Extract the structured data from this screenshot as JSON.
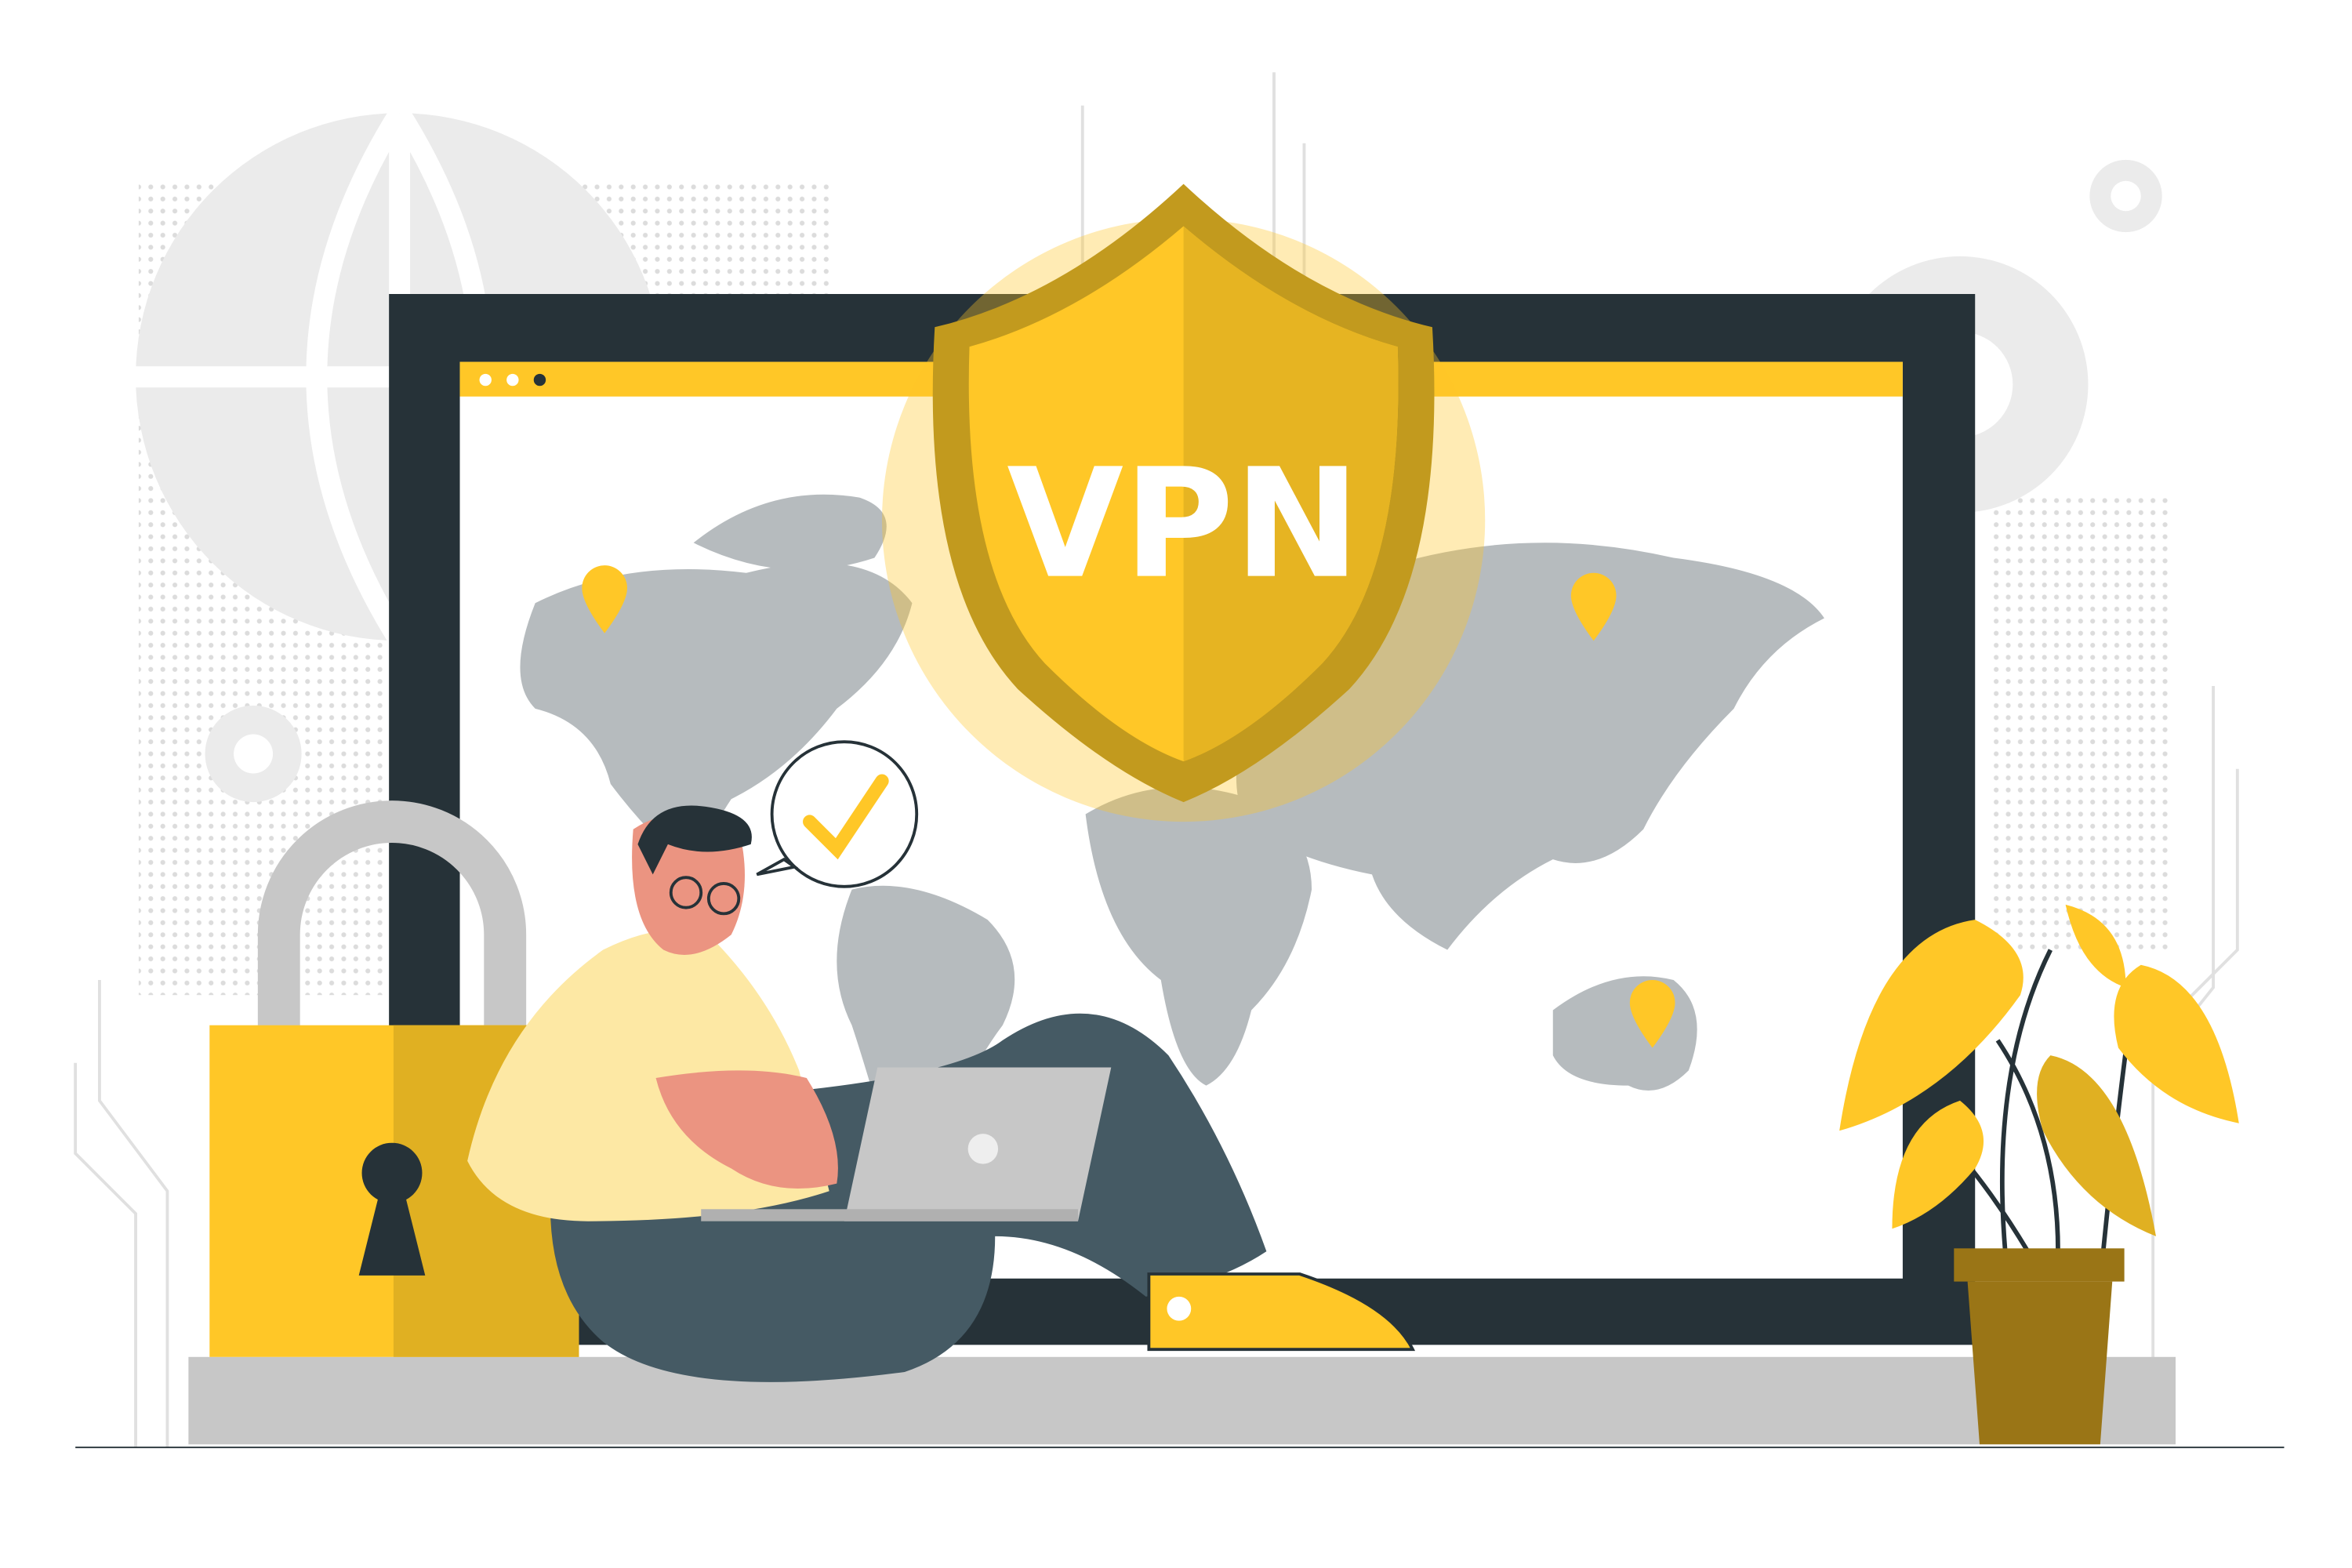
{
  "shield": {
    "label": "VPN"
  },
  "colors": {
    "accent_yellow": "#FFC727",
    "dark_yellow": "#E0B022",
    "frame_dark": "#263238",
    "map_gray": "#B6BBBE",
    "background_gray": "#EBEBEB",
    "pants": "#455A64",
    "skin": "#EB9481",
    "hoodie": "#FDE8A4",
    "pot": "#9A7516"
  },
  "icons": [
    "globe-icon",
    "gear-icon",
    "location-pin-icon",
    "checkmark-icon",
    "padlock-icon",
    "shield-icon",
    "laptop-icon",
    "plant-icon"
  ]
}
